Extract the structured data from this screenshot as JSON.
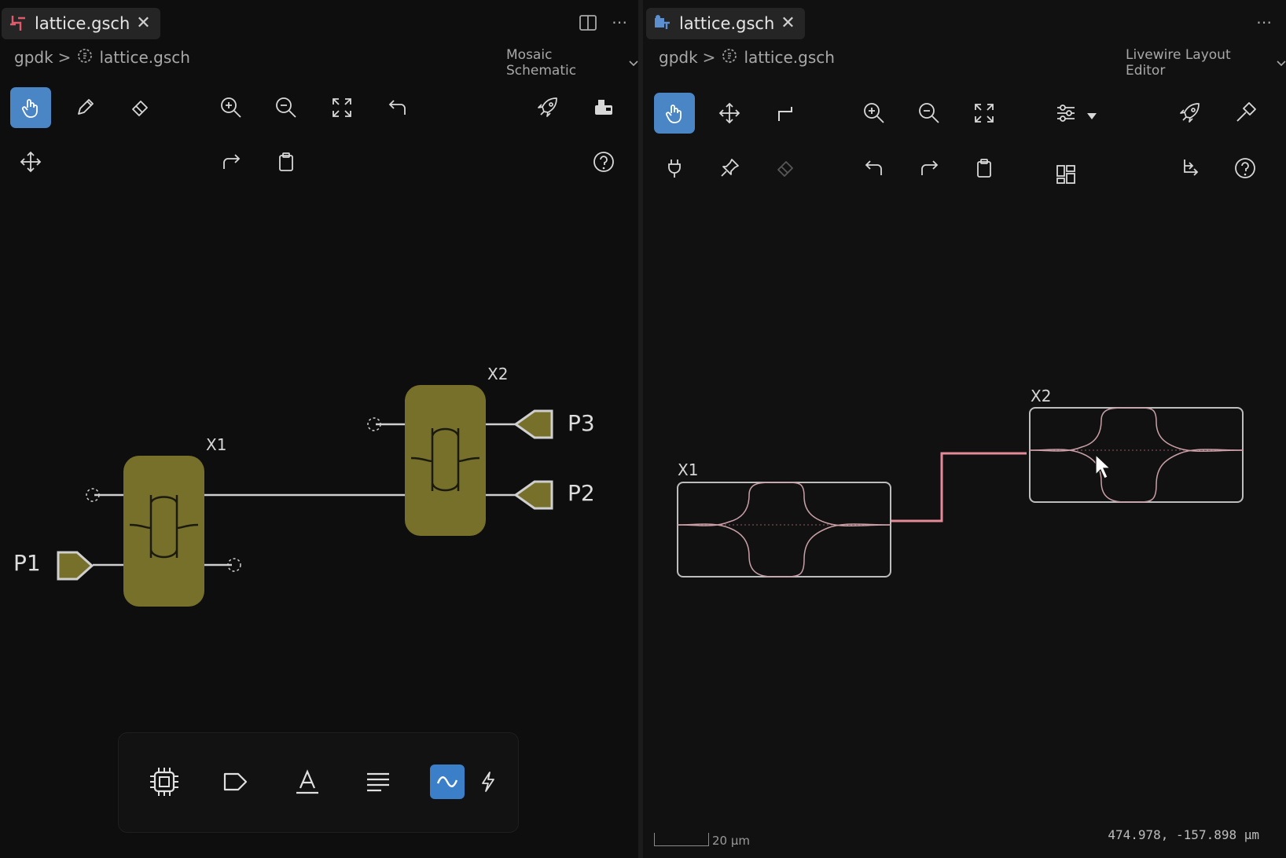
{
  "left_editor": {
    "tab": {
      "label": "lattice.gsch",
      "close": "✕"
    },
    "breadcrumb": {
      "root": "gpdk",
      "separator": ">",
      "file": "lattice.gsch"
    },
    "editor_name": "Mosaic Schematic",
    "toolbar_icons": [
      "select-hand-icon",
      "pencil-icon",
      "eraser-icon",
      "zoom-in-icon",
      "zoom-out-icon",
      "fit-view-icon",
      "undo-icon",
      "rocket-icon",
      "generate-icon",
      "move-icon",
      "redo-icon",
      "clipboard-icon",
      "help-icon"
    ],
    "components": [
      {
        "name": "X1"
      },
      {
        "name": "X2"
      }
    ],
    "ports": [
      {
        "name": "P1"
      },
      {
        "name": "P2"
      },
      {
        "name": "P3"
      }
    ],
    "palette_icons": [
      "chip-icon",
      "port-tag-icon",
      "text-icon",
      "align-icon",
      "waveguide-icon",
      "lightning-icon"
    ],
    "palette_active": "waveguide-icon",
    "colors": {
      "component_fill": "#77702a",
      "wire": "#cfcfcf",
      "active_tool": "#4a86c6"
    }
  },
  "right_editor": {
    "tab": {
      "label": "lattice.gsch",
      "close": "✕"
    },
    "breadcrumb": {
      "root": "gpdk",
      "separator": ">",
      "file": "lattice.gsch"
    },
    "editor_name": "Livewire Layout Editor",
    "toolbar_icons": [
      "select-hand-icon",
      "move-icon",
      "route-icon",
      "zoom-in-icon",
      "zoom-out-icon",
      "fit-view-icon",
      "filter-icon",
      "rocket-icon",
      "hammer-icon",
      "plug-icon",
      "pin-icon",
      "eraser-icon",
      "undo-icon",
      "redo-icon",
      "clipboard-icon",
      "layout-grid-icon",
      "route-branch-icon",
      "help-icon"
    ],
    "components": [
      {
        "name": "X1"
      },
      {
        "name": "X2"
      }
    ],
    "scale_label": "20 μm",
    "coordinates": "474.978, -157.898 μm",
    "colors": {
      "waveguide": "#e48a98",
      "box": "#bdbdbd"
    }
  }
}
